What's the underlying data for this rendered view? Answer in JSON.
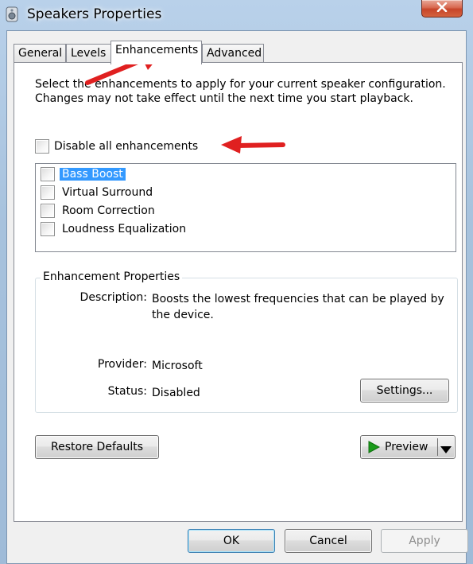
{
  "window": {
    "title": "Speakers Properties",
    "title_icon": "speaker-icon",
    "close_icon": "close-icon"
  },
  "tabs": [
    {
      "label": "General",
      "active": false
    },
    {
      "label": "Levels",
      "active": false
    },
    {
      "label": "Enhancements",
      "active": true
    },
    {
      "label": "Advanced",
      "active": false
    }
  ],
  "enhancements": {
    "intro": "Select the enhancements to apply for your current speaker configuration. Changes may not take effect until the next time you start playback.",
    "disable_all": {
      "label": "Disable all enhancements",
      "checked": false
    },
    "items": [
      {
        "label": "Bass Boost",
        "checked": false,
        "selected": true
      },
      {
        "label": "Virtual Surround",
        "checked": false,
        "selected": false
      },
      {
        "label": "Room Correction",
        "checked": false,
        "selected": false
      },
      {
        "label": "Loudness Equalization",
        "checked": false,
        "selected": false
      }
    ],
    "properties": {
      "title": "Enhancement Properties",
      "description_label": "Description:",
      "description_value": "Boosts the lowest frequencies that can be played by the device.",
      "provider_label": "Provider:",
      "provider_value": "Microsoft",
      "status_label": "Status:",
      "status_value": "Disabled",
      "settings_button": "Settings..."
    },
    "restore_defaults_button": "Restore Defaults",
    "preview_button": "Preview",
    "preview_icon": "play-icon",
    "preview_dropdown_icon": "chevron-down-icon"
  },
  "footer": {
    "ok": "OK",
    "cancel": "Cancel",
    "apply": "Apply",
    "apply_enabled": false
  },
  "annotations": {
    "arrow_color": "#e02020",
    "arrows": [
      "arrow-pointing-to-enhancements-tab",
      "arrow-pointing-to-disable-all-enhancements"
    ]
  },
  "colors": {
    "selection": "#3399ff",
    "play_green": "#1a9b1a",
    "close_red": "#c7452a"
  }
}
